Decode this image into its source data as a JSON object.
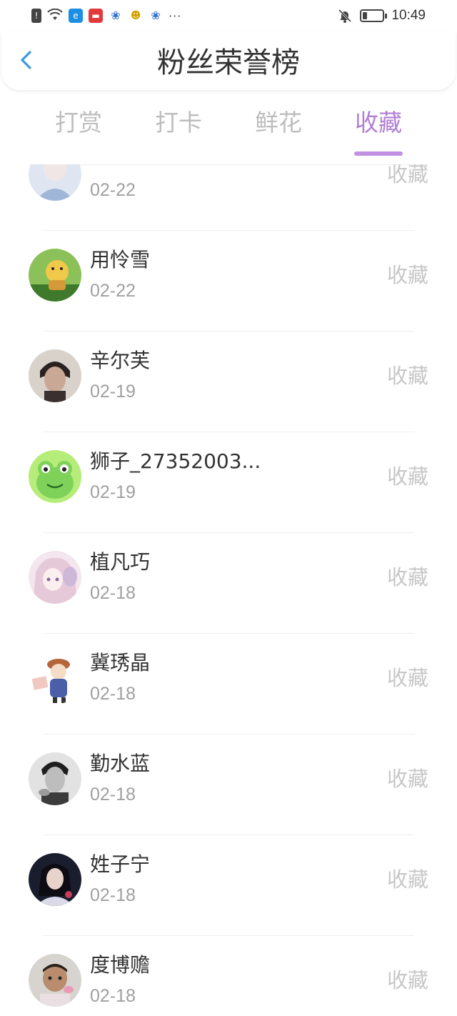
{
  "status_bar": {
    "time": "10:49",
    "icons": [
      "alert-icon",
      "wifi-icon",
      "ele-app-icon",
      "red-app-icon",
      "baidu-paw-icon",
      "chick-app-icon",
      "baidu-paw-icon",
      "more-dots-icon",
      "bell-off-icon",
      "battery-icon"
    ]
  },
  "header": {
    "title": "粉丝荣誉榜",
    "back_icon": "chevron-left-icon"
  },
  "tabs": [
    {
      "label": "打赏",
      "active": false
    },
    {
      "label": "打卡",
      "active": false
    },
    {
      "label": "鲜花",
      "active": false
    },
    {
      "label": "收藏",
      "active": true
    }
  ],
  "colors": {
    "accent": "#b07fd4",
    "tab_inactive": "#bdbdbd",
    "back_arrow": "#3a9be0"
  },
  "fans": [
    {
      "name": "",
      "date": "02-22",
      "action": "收藏",
      "avatar": "partial-avatar-icon"
    },
    {
      "name": "用怜雪",
      "date": "02-22",
      "action": "收藏",
      "avatar": "toy-duck-avatar-icon"
    },
    {
      "name": "辛尔芙",
      "date": "02-19",
      "action": "收藏",
      "avatar": "man-portrait-avatar-icon"
    },
    {
      "name": "狮子_27352003...",
      "date": "02-19",
      "action": "收藏",
      "avatar": "frog-avatar-icon"
    },
    {
      "name": "植凡巧",
      "date": "02-18",
      "action": "收藏",
      "avatar": "anime-girl-avatar-icon"
    },
    {
      "name": "冀琇晶",
      "date": "02-18",
      "action": "收藏",
      "avatar": "cartoon-boy-avatar-icon"
    },
    {
      "name": "勤水蓝",
      "date": "02-18",
      "action": "收藏",
      "avatar": "bw-man-avatar-icon"
    },
    {
      "name": "姓子宁",
      "date": "02-18",
      "action": "收藏",
      "avatar": "girl-night-avatar-icon"
    },
    {
      "name": "度博赡",
      "date": "02-18",
      "action": "收藏",
      "avatar": "child-avatar-icon"
    }
  ]
}
